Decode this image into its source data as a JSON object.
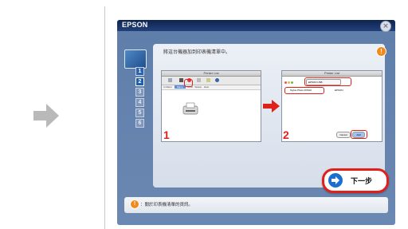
{
  "window": {
    "title": "EPSON",
    "close_icon": "×"
  },
  "wizard": {
    "instruction": "將這台機器加到印表機清單中。",
    "info_icon": "!",
    "steps": [
      "1",
      "2",
      "3",
      "4",
      "5",
      "6"
    ],
    "next_button": "下一步",
    "footer_icon": "!",
    "footer_text": "：關於印表機清單的資訊。"
  },
  "screenshot1": {
    "title": "Printer List",
    "number": "1",
    "columns": [
      "In Menu",
      "Name",
      "Kind",
      "Status",
      "Host"
    ]
  },
  "screenshot2": {
    "title": "Printer List",
    "number": "2",
    "dropdown": "EPSON USB",
    "list_item": "Stylus Photo RX610",
    "kind": "EPSON",
    "cancel": "Cancel",
    "add": "Add"
  },
  "colors": {
    "accent_red": "#e0201a",
    "brand_blue": "#1d6fcf",
    "info_orange": "#f08a1c"
  }
}
